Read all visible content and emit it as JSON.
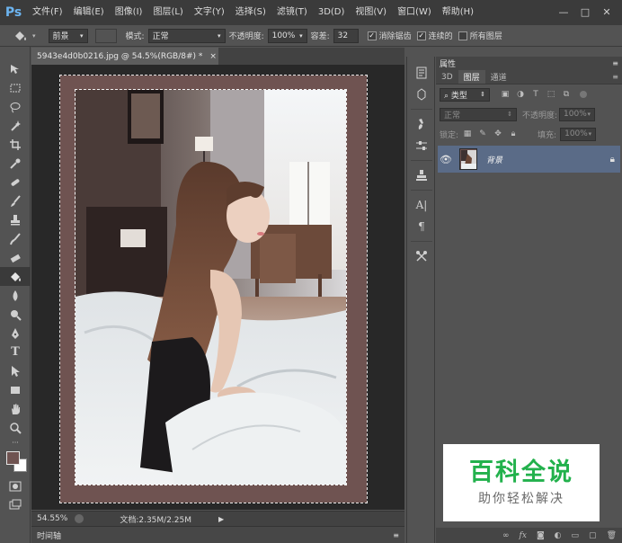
{
  "app": {
    "logo": "Ps"
  },
  "menu": [
    "文件(F)",
    "编辑(E)",
    "图像(I)",
    "图层(L)",
    "文字(Y)",
    "选择(S)",
    "滤镜(T)",
    "3D(D)",
    "视图(V)",
    "窗口(W)",
    "帮助(H)"
  ],
  "window_controls": {
    "minimize": "—",
    "restore": "□",
    "close": "✕"
  },
  "options": {
    "fill_source": "前景",
    "mode_label": "模式:",
    "mode_value": "正常",
    "opacity_label": "不透明度:",
    "opacity_value": "100%",
    "tolerance_label": "容差:",
    "tolerance_value": "32",
    "antialias_label": "消除锯齿",
    "antialias_checked": true,
    "contiguous_label": "连续的",
    "contiguous_checked": true,
    "all_layers_label": "所有图层",
    "all_layers_checked": false
  },
  "document": {
    "tab_title": "5943e4d0b0216.jpg @ 54.5%(RGB/8#) *",
    "close": "×"
  },
  "status": {
    "zoom": "54.55%",
    "doc_info": "文档:2.35M/2.25M"
  },
  "timeline_label": "时间轴",
  "panels": {
    "properties_title": "属性",
    "tabs": [
      "3D",
      "图层",
      "通道"
    ],
    "active_tab": "图层",
    "filter_kind": "类型",
    "blend_mode": "正常",
    "opacity_label": "不透明度:",
    "opacity_value": "100%",
    "lock_label": "锁定:",
    "fill_label": "填充:",
    "fill_value": "100%"
  },
  "layers": [
    {
      "name": "背景",
      "visible": true,
      "locked": true
    }
  ],
  "watermark": {
    "title": "百科全说",
    "subtitle": "助你轻松解决"
  },
  "colors": {
    "foreground": "#6f5351",
    "background": "#ffffff",
    "border_fill": "#6f5351",
    "selected_layer": "#5a6b87",
    "watermark_green": "#22b14c"
  }
}
